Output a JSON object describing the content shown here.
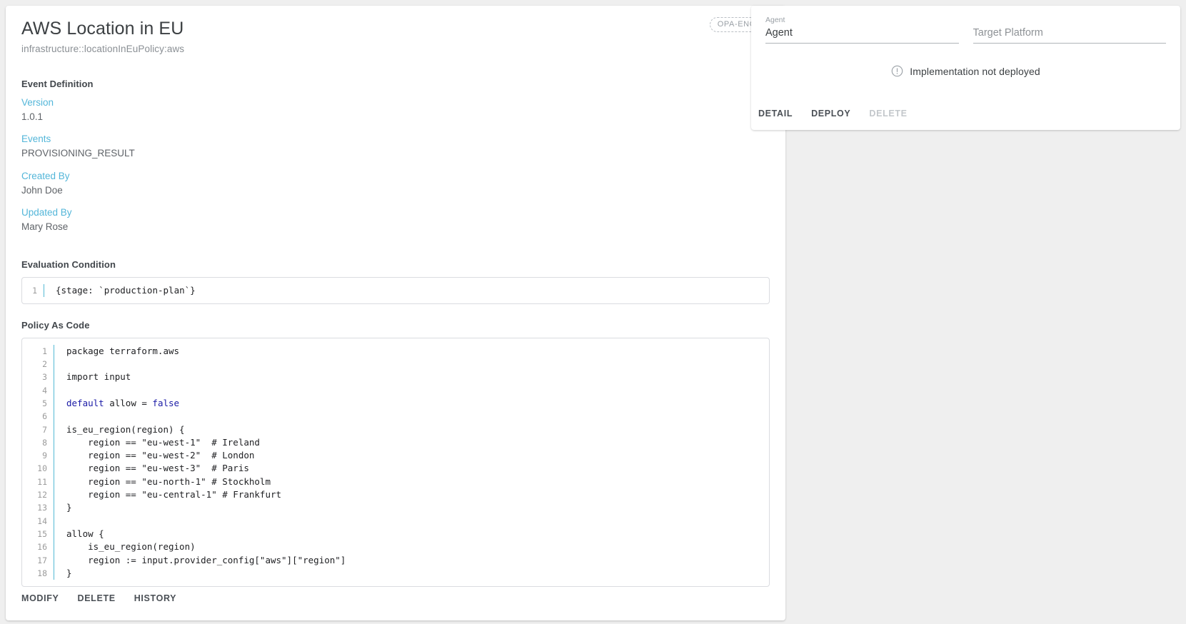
{
  "main": {
    "title": "AWS Location in EU",
    "subtitle": "infrastructure::locationInEuPolicy:aws",
    "engine_badge": "OPA-ENGINE",
    "event_definition_title": "Event Definition",
    "fields": [
      {
        "label": "Version",
        "value": "1.0.1"
      },
      {
        "label": "Events",
        "value": "PROVISIONING_RESULT"
      },
      {
        "label": "Created By",
        "value": "John Doe"
      },
      {
        "label": "Updated By",
        "value": "Mary Rose"
      }
    ],
    "evaluation_condition_title": "Evaluation Condition",
    "evaluation_condition_lines": [
      {
        "n": "1",
        "text": "{stage: `production-plan`}"
      }
    ],
    "policy_as_code_title": "Policy As Code",
    "policy_lines": [
      {
        "n": "1",
        "text": "package terraform.aws"
      },
      {
        "n": "2",
        "text": ""
      },
      {
        "n": "3",
        "text": "import input"
      },
      {
        "n": "4",
        "text": ""
      },
      {
        "n": "5",
        "text": "default allow = false",
        "kw_pre": "default",
        "kw_post": "false",
        "mid": " allow = "
      },
      {
        "n": "6",
        "text": ""
      },
      {
        "n": "7",
        "text": "is_eu_region(region) {"
      },
      {
        "n": "8",
        "text": "    region == \"eu-west-1\"  # Ireland"
      },
      {
        "n": "9",
        "text": "    region == \"eu-west-2\"  # London"
      },
      {
        "n": "10",
        "text": "    region == \"eu-west-3\"  # Paris"
      },
      {
        "n": "11",
        "text": "    region == \"eu-north-1\" # Stockholm"
      },
      {
        "n": "12",
        "text": "    region == \"eu-central-1\" # Frankfurt"
      },
      {
        "n": "13",
        "text": "}"
      },
      {
        "n": "14",
        "text": ""
      },
      {
        "n": "15",
        "text": "allow {"
      },
      {
        "n": "16",
        "text": "    is_eu_region(region)"
      },
      {
        "n": "17",
        "text": "    region := input.provider_config[\"aws\"][\"region\"]"
      },
      {
        "n": "18",
        "text": "}"
      }
    ],
    "actions": [
      {
        "label": "MODIFY",
        "disabled": false
      },
      {
        "label": "DELETE",
        "disabled": false
      },
      {
        "label": "HISTORY",
        "disabled": false
      }
    ]
  },
  "side": {
    "agent_label": "Agent",
    "agent_value": "Agent",
    "target_platform_label": "",
    "target_platform_placeholder": "Target Platform",
    "target_platform_value": "",
    "status_icon": "exclamation-circle-icon",
    "status_text": "Implementation not deployed",
    "actions": [
      {
        "label": "DETAIL",
        "disabled": false
      },
      {
        "label": "DEPLOY",
        "disabled": false
      },
      {
        "label": "DELETE",
        "disabled": true
      }
    ]
  },
  "colors": {
    "page_bg": "#efefef",
    "card_bg": "#ffffff",
    "accent_label": "#53b6d9",
    "gutter_accent": "#54b9d4",
    "keyword": "#1a1aa6",
    "muted": "#9aa0a6"
  }
}
